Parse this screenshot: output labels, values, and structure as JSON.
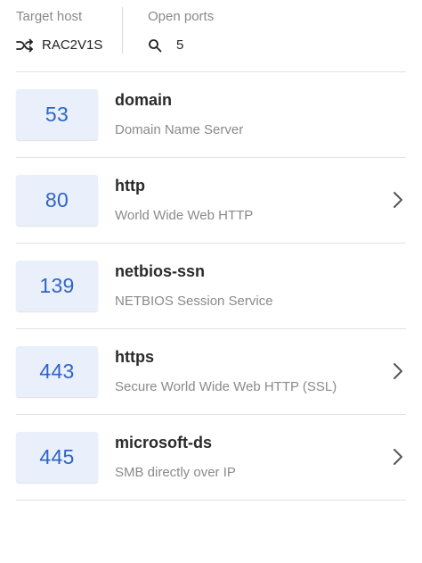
{
  "header": {
    "target_label": "Target host",
    "target_value": "RAC2V1S",
    "target_icon": "shuffle-icon",
    "ports_label": "Open ports",
    "ports_value": "5",
    "ports_icon": "search-icon"
  },
  "ports": [
    {
      "port": "53",
      "service": "domain",
      "description": "Domain Name Server",
      "has_chevron": false
    },
    {
      "port": "80",
      "service": "http",
      "description": "World Wide Web HTTP",
      "has_chevron": true
    },
    {
      "port": "139",
      "service": "netbios-ssn",
      "description": "NETBIOS Session Service",
      "has_chevron": false
    },
    {
      "port": "443",
      "service": "https",
      "description": "Secure World Wide Web HTTP (SSL)",
      "has_chevron": true
    },
    {
      "port": "445",
      "service": "microsoft-ds",
      "description": "SMB directly over IP",
      "has_chevron": true
    }
  ],
  "colors": {
    "port_text": "#2f63c9",
    "port_bg": "#e9f0fb",
    "muted_text": "#8a8a8a"
  }
}
